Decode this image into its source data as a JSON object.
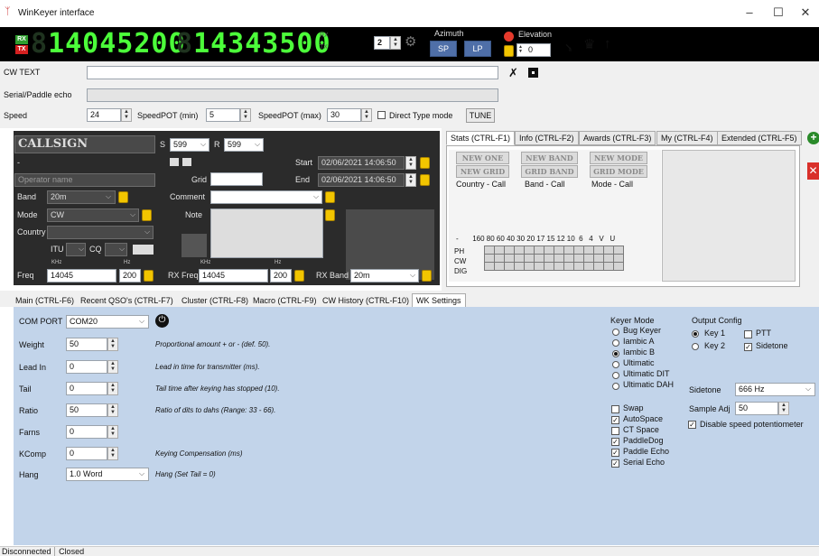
{
  "window": {
    "title": "WinKeyer interface",
    "minimize": "–",
    "maximize": "☐",
    "close": "✕"
  },
  "display": {
    "rx_badge": "RX",
    "tx_badge": "TX",
    "rx_digits": "14045200",
    "rx_dim": "8",
    "tx_dim": "8",
    "tx_digits": "14343500",
    "small_rx": "RX",
    "small_tx": "TX",
    "rotor_num": "2",
    "azimuth_label": "Azimuth",
    "sp_label": "SP",
    "lp_label": "LP",
    "elevation_label": "Elevation",
    "elevation_value": "0",
    "icons": [
      "antenna-icon",
      "castle-icon",
      "arrow-up-icon"
    ]
  },
  "cw": {
    "cw_text_label": "CW TEXT",
    "echo_label": "Serial/Paddle echo",
    "speed_label": "Speed",
    "speed_value": "24",
    "speedpot_min_label": "SpeedPOT (min)",
    "speedpot_min_value": "5",
    "speedpot_max_label": "SpeedPOT (max)",
    "speedpot_max_value": "30",
    "direct_label": "Direct Type mode",
    "tune_label": "TUNE"
  },
  "qso": {
    "callsign_placeholder": "CALLSIGN",
    "s_label": "S",
    "s_value": "599",
    "r_label": "R",
    "r_value": "599",
    "dash": "-",
    "start_label": "Start",
    "start_value": "02/06/2021 14:06:50",
    "end_label": "End",
    "end_value": "02/06/2021 14:06:50",
    "operator_placeholder": "Operator name",
    "grid_label": "Grid",
    "band_label": "Band",
    "band_value": "20m",
    "comment_label": "Comment",
    "mode_label": "Mode",
    "mode_value": "CW",
    "note_label": "Note",
    "country_label": "Country",
    "itu_label": "ITU",
    "cq_label": "CQ",
    "khz_label": "KHz",
    "hz_label": "Hz",
    "freq_label": "Freq",
    "freq_khz": "14045",
    "freq_hz": "200",
    "rxfreq_label": "RX Freq",
    "rxfreq_khz": "14045",
    "rxfreq_hz": "200",
    "rxband_label": "RX Band",
    "rxband_value": "20m"
  },
  "stats_tabs": [
    "Stats (CTRL-F1)",
    "Info (CTRL-F2)",
    "Awards (CTRL-F3)",
    "My (CTRL-F4)",
    "Extended (CTRL-F5)"
  ],
  "stats": {
    "new_one": "NEW ONE",
    "new_band": "NEW BAND",
    "new_mode": "NEW MODE",
    "new_grid": "NEW GRID",
    "grid_band": "GRID BAND",
    "grid_mode": "GRID MODE",
    "country_call": "Country - Call",
    "band_call": "Band - Call",
    "mode_call": "Mode - Call",
    "bands_header": "-       160 80 60 40 30 20 17 15 12 10  6   4   V   U",
    "rows": [
      "PH",
      "CW",
      "DIG"
    ]
  },
  "main_tabs": [
    "Main (CTRL-F6)",
    "Recent QSO's (CTRL-F7)",
    "Cluster (CTRL-F8)",
    "Macro (CTRL-F9)",
    "CW History (CTRL-F10)",
    "WK Settings"
  ],
  "wk": {
    "com_port_label": "COM PORT",
    "com_port_value": "COM20",
    "rows": [
      {
        "label": "Weight",
        "value": "50",
        "help": "Proportional amount + or - (def. 50)."
      },
      {
        "label": "Lead In",
        "value": "0",
        "help": "Lead in time for transmitter (ms)."
      },
      {
        "label": "Tail",
        "value": "0",
        "help": "Tail time after keying has stopped (10)."
      },
      {
        "label": "Ratio",
        "value": "50",
        "help": "Ratio of dits to dahs (Range: 33 - 66)."
      },
      {
        "label": "Farns",
        "value": "0",
        "help": ""
      },
      {
        "label": "KComp",
        "value": "0",
        "help": "Keying Compensation (ms)"
      },
      {
        "label": "Hang",
        "value": "1.0 Word",
        "help": "Hang (Set Tail = 0)"
      }
    ],
    "keyer_mode_label": "Keyer Mode",
    "keyer_modes": [
      "Bug Keyer",
      "Iambic A",
      "Iambic B",
      "Ultimatic",
      "Ultimatic DIT",
      "Ultimatic DAH"
    ],
    "keyer_selected": 2,
    "checks": [
      "Swap",
      "AutoSpace",
      "CT Space",
      "PaddleDog",
      "Paddle Echo",
      "Serial Echo"
    ],
    "checks_on": [
      false,
      true,
      false,
      true,
      true,
      true
    ],
    "output_label": "Output Config",
    "key1": "Key 1",
    "key2": "Key 2",
    "ptt": "PTT",
    "sidetone_chk": "Sidetone",
    "sidetone_label": "Sidetone",
    "sidetone_value": "666 Hz",
    "sample_label": "Sample Adj",
    "sample_value": "50",
    "disable_label": "Disable speed potentiometer"
  },
  "status": {
    "left": "Disconnected",
    "right": "Closed"
  },
  "colors": {
    "lcd_bg": "#000000",
    "digits": "#4cff3a",
    "panel_dark": "#2b2b2b",
    "settings_bg": "#c2d4ea"
  }
}
